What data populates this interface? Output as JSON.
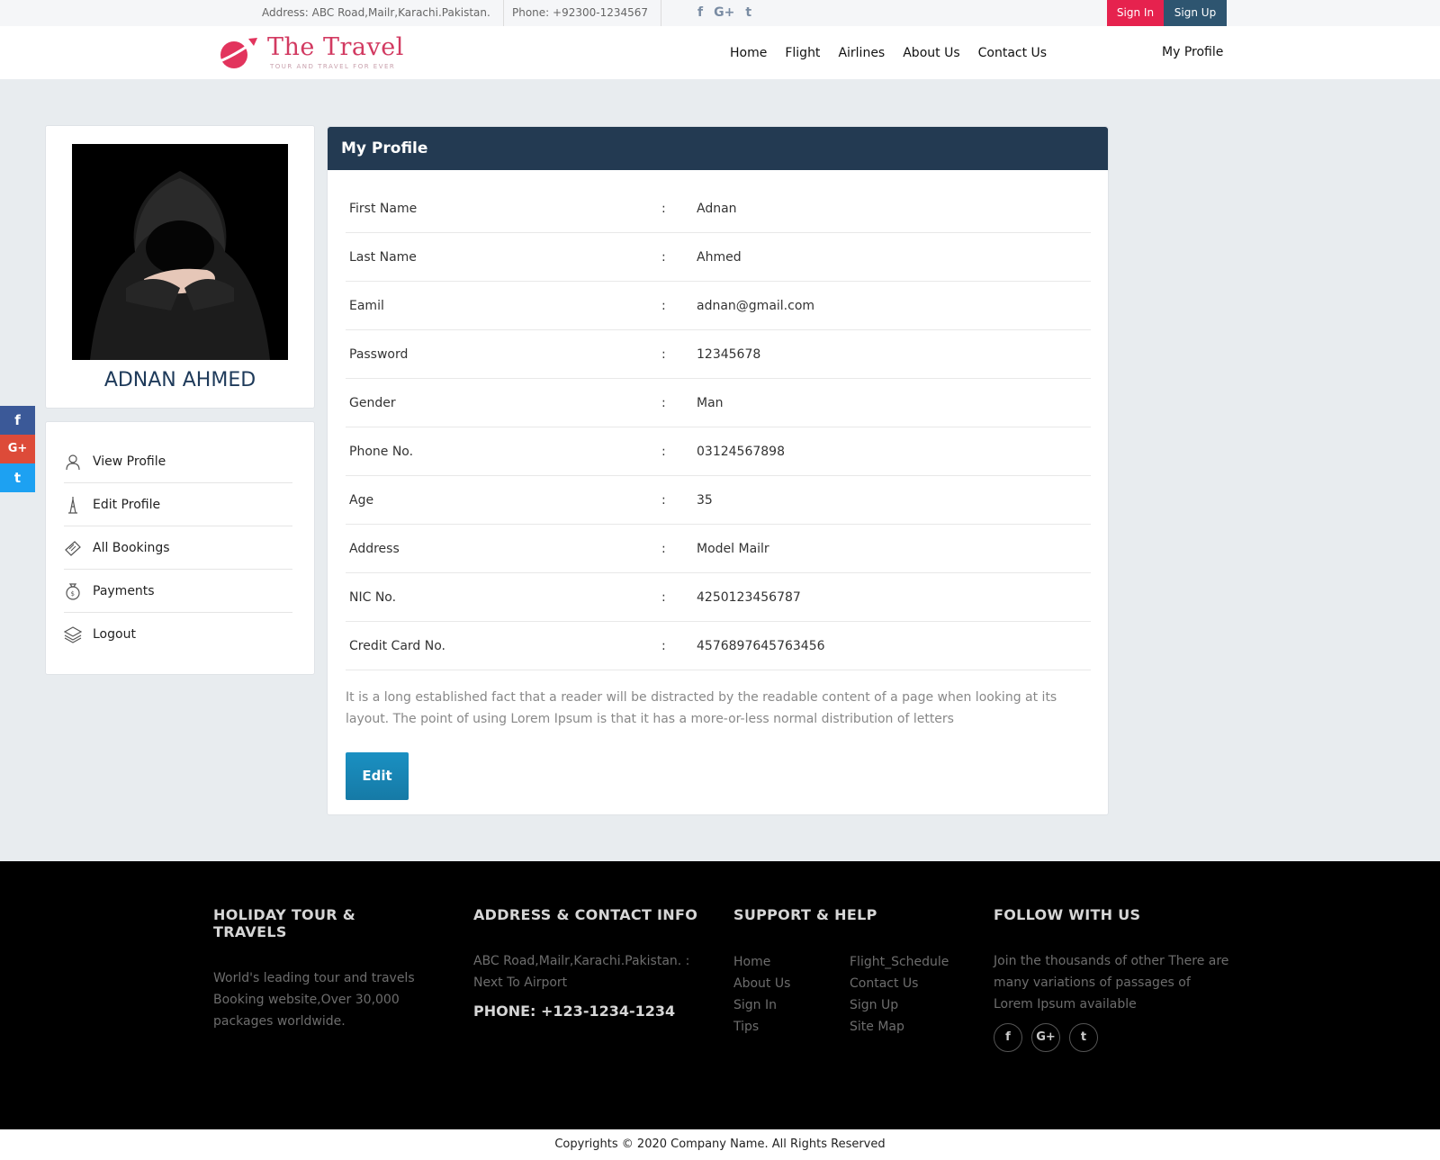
{
  "topbar": {
    "address": "Address: ABC Road,Mailr,Karachi.Pakistan.",
    "phone": "Phone: +92300-1234567",
    "social_icons": [
      "facebook-icon",
      "google-plus-icon",
      "twitter-icon"
    ],
    "social_glyphs": [
      "f",
      "G+",
      "t"
    ],
    "signin_label": "Sign In",
    "signup_label": "Sign Up"
  },
  "header": {
    "logo_title": "The Travel",
    "logo_tagline": "TOUR AND TRAVEL FOR EVER",
    "nav": [
      "Home",
      "Flight",
      "Airlines",
      "About Us",
      "Contact Us"
    ],
    "my_profile": "My Profile"
  },
  "side_social": {
    "items": [
      {
        "icon": "facebook-icon",
        "glyph": "f",
        "color": "#3b5998"
      },
      {
        "icon": "google-plus-icon",
        "glyph": "G+",
        "color": "#dd4b39"
      },
      {
        "icon": "twitter-icon",
        "glyph": "t",
        "color": "#1da1f2"
      }
    ]
  },
  "profile_card": {
    "name": "ADNAN AHMED"
  },
  "menu": {
    "items": [
      {
        "label": "View Profile",
        "icon": "user-icon"
      },
      {
        "label": "Edit Profile",
        "icon": "tower-icon"
      },
      {
        "label": "All Bookings",
        "icon": "ticket-icon"
      },
      {
        "label": "Payments",
        "icon": "money-bag-icon"
      },
      {
        "label": "Logout",
        "icon": "layers-icon"
      }
    ]
  },
  "main": {
    "title": "My Profile",
    "fields": [
      {
        "label": "First Name",
        "value": "Adnan"
      },
      {
        "label": "Last Name",
        "value": "Ahmed"
      },
      {
        "label": "Eamil",
        "value": "adnan@gmail.com"
      },
      {
        "label": "Password",
        "value": "12345678"
      },
      {
        "label": "Gender",
        "value": "Man"
      },
      {
        "label": "Phone No.",
        "value": "03124567898"
      },
      {
        "label": "Age",
        "value": "35"
      },
      {
        "label": "Address",
        "value": "Model Mailr"
      },
      {
        "label": "NIC No.",
        "value": "4250123456787"
      },
      {
        "label": "Credit Card No.",
        "value": "4576897645763456"
      }
    ],
    "separator": ":",
    "description": "It is a long established fact that a reader will be distracted by the readable content of a page when looking at its layout. The point of using Lorem Ipsum is that it has a more-or-less normal distribution of letters",
    "edit_label": "Edit"
  },
  "footer": {
    "col1_title": "HOLIDAY TOUR & TRAVELS",
    "col1_text": "World's leading tour and travels Booking website,Over 30,000 packages worldwide.",
    "col2_title": "ADDRESS & CONTACT INFO",
    "col2_text": "ABC Road,Mailr,Karachi.Pakistan. : Next To Airport",
    "col2_phone": "PHONE: +123-1234-1234",
    "col3_title": "SUPPORT & HELP",
    "links_left": [
      "Home",
      "About Us",
      "Sign In",
      "Tips"
    ],
    "links_right": [
      "Flight_Schedule",
      "Contact Us",
      "Sign Up",
      "Site Map"
    ],
    "col4_title": "FOLLOW WITH US",
    "col4_text": "Join the thousands of other There are many variations of passages of Lorem Ipsum available",
    "social_icons": [
      "facebook-icon",
      "google-plus-icon",
      "twitter-icon"
    ],
    "social_glyphs": [
      "f",
      "G+",
      "t"
    ]
  },
  "copyright": "Copyrights © 2020 Company Name. All Rights Reserved"
}
